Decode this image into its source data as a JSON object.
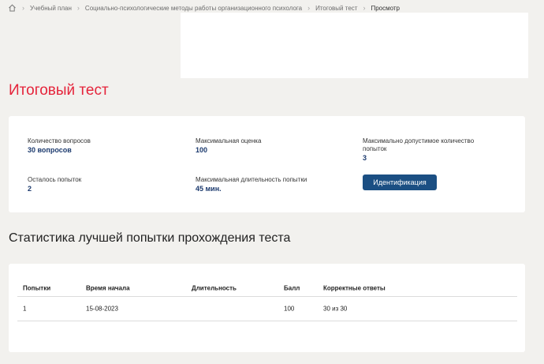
{
  "breadcrumb": {
    "home_icon": "home-icon",
    "items": [
      "Учебный план",
      "Социально-психологические методы работы организационного психолога",
      "Итоговый тест"
    ],
    "current": "Просмотр"
  },
  "page_title": "Итоговый тест",
  "info": {
    "questions_label": "Количество вопросов",
    "questions_value": "30 вопросов",
    "max_score_label": "Максимальная оценка",
    "max_score_value": "100",
    "max_attempts_label": "Максимально допустимое количество попыток",
    "max_attempts_value": "3",
    "attempts_left_label": "Осталось попыток",
    "attempts_left_value": "2",
    "max_duration_label": "Максимальная длительность попытки",
    "max_duration_value": "45 мин.",
    "identify_button": "Идентификация"
  },
  "stats": {
    "title": "Статистика лучшей попытки прохождения теста",
    "columns": [
      "Попытки",
      "Время начала",
      "Длительность",
      "Балл",
      "Корректные ответы"
    ],
    "rows": [
      [
        "1",
        "15-08-2023",
        "",
        "100",
        "30 из 30"
      ]
    ]
  },
  "colors": {
    "title_red": "#e5243b",
    "button_blue": "#1b4f83",
    "value_blue": "#1c3a6e",
    "background": "#f2f1ee"
  }
}
